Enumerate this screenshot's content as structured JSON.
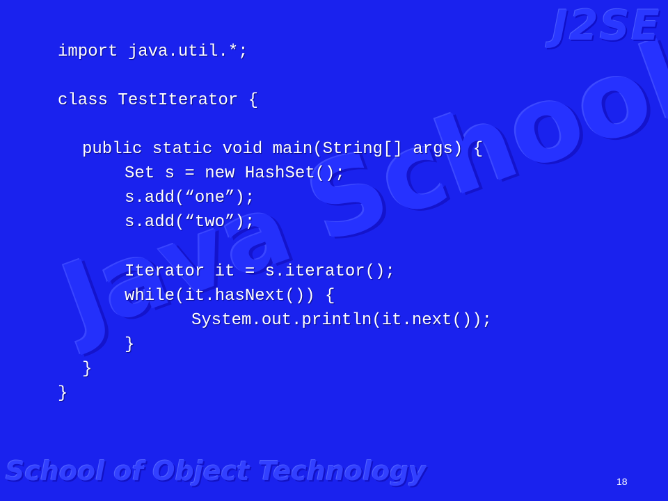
{
  "watermarks": {
    "corner_logo": "J2SE",
    "background_word_1": "Java",
    "background_word_2": "School",
    "footer_banner": "School of Object Technology"
  },
  "code_lines": [
    "import java.util.*;",
    "class TestIterator {",
    "public static void main(String[] args) {",
    "Set s = new HashSet();",
    "s.add(“one”);",
    "s.add(“two”);",
    "Iterator it = s.iterator();",
    "while(it.hasNext()) {",
    "System.out.println(it.next());",
    "}",
    "}",
    "}"
  ],
  "page_number": "18",
  "colors": {
    "background": "#1a22ee",
    "text": "#ffffff",
    "watermark": "#2632ff"
  }
}
